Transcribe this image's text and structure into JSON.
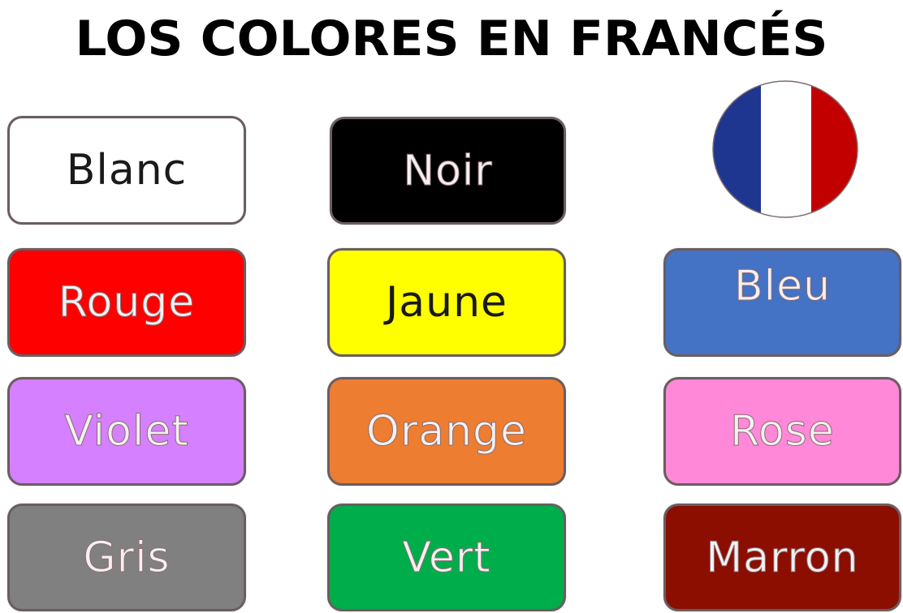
{
  "title": "LOS COLORES EN FRANCÉS",
  "flag": {
    "colors": {
      "blue": "#1f3690",
      "white": "#ffffff",
      "red": "#c20000"
    },
    "icon": "french-flag-icon"
  },
  "colors": [
    {
      "label": "Blanc",
      "bg": "#ffffff",
      "text": "#1a1a1a"
    },
    {
      "label": "Noir",
      "bg": "#000000",
      "text": "#f3f1f1"
    },
    {
      "label": "Rouge",
      "bg": "#ff0000",
      "text": "#f3f1f1"
    },
    {
      "label": "Jaune",
      "bg": "#ffff00",
      "text": "#1a1a1a"
    },
    {
      "label": "Bleu",
      "bg": "#4472c4",
      "text": "#f3f1f1"
    },
    {
      "label": "Violet",
      "bg": "#d580ff",
      "text": "#f3f1f1"
    },
    {
      "label": "Orange",
      "bg": "#ed7d31",
      "text": "#f3f1f1"
    },
    {
      "label": "Rose",
      "bg": "#ff88d8",
      "text": "#f3f1f1"
    },
    {
      "label": "Gris",
      "bg": "#808080",
      "text": "#f3f1f1"
    },
    {
      "label": "Vert",
      "bg": "#00ad4b",
      "text": "#f3f1f1"
    },
    {
      "label": "Marron",
      "bg": "#8b0e00",
      "text": "#f3f1f1"
    }
  ]
}
